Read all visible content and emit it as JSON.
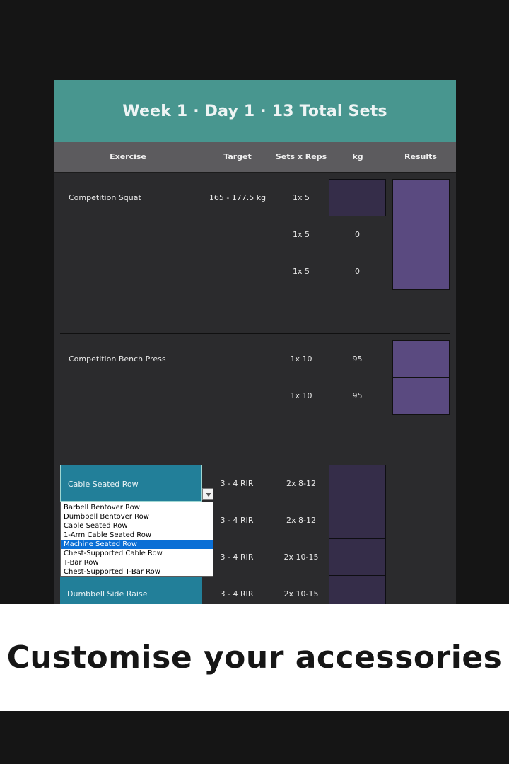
{
  "title": "Week 1 · Day 1 · 13 Total Sets",
  "headers": {
    "exercise": "Exercise",
    "target": "Target",
    "sets_reps": "Sets x Reps",
    "kg": "kg",
    "results": "Results"
  },
  "blocks": [
    {
      "exercise": "Competition Squat",
      "target": "165 - 177.5 kg",
      "sets": [
        {
          "reps": "1x 5",
          "kg": ""
        },
        {
          "reps": "1x 5",
          "kg": "0"
        },
        {
          "reps": "1x 5",
          "kg": "0"
        }
      ]
    },
    {
      "exercise": "Competition Bench Press",
      "target": "",
      "sets": [
        {
          "reps": "1x 10",
          "kg": "95"
        },
        {
          "reps": "1x 10",
          "kg": "95"
        }
      ]
    }
  ],
  "accessories": [
    {
      "exercise": "Cable Seated Row",
      "target": "3 - 4 RIR",
      "reps": "2x 8-12"
    },
    {
      "exercise": "",
      "target": "3 - 4 RIR",
      "reps": "2x 8-12"
    },
    {
      "exercise": "",
      "target": "3 - 4 RIR",
      "reps": "2x 10-15"
    },
    {
      "exercise": "Dumbbell Side Raise",
      "target": "3 - 4 RIR",
      "reps": "2x 10-15"
    }
  ],
  "dropdown": {
    "options": [
      "Barbell Bentover Row",
      "Dumbbell Bentover Row",
      "Cable Seated Row",
      "1-Arm Cable Seated Row",
      "Machine Seated Row",
      "Chest-Supported Cable Row",
      "T-Bar Row",
      "Chest-Supported T-Bar Row"
    ],
    "highlighted": "Machine Seated Row"
  },
  "caption": "Customise your accessories",
  "colors": {
    "header_band": "#48968f",
    "accessory_cell": "#227f99",
    "kg_cell": "#352d49",
    "result_cell": "#5a4a80",
    "highlight": "#0a6fd6"
  }
}
